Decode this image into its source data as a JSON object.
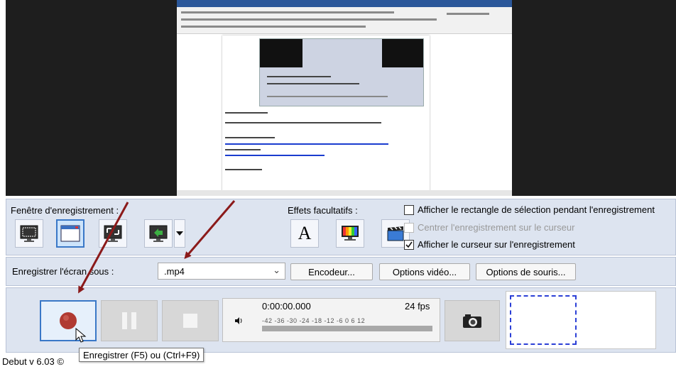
{
  "recording_panel": {
    "label": "Fenêtre d'enregistrement :",
    "effects_label": "Effets facultatifs :",
    "options": [
      {
        "label": "Afficher le rectangle de sélection pendant l'enregistrement",
        "checked": false,
        "enabled": true
      },
      {
        "label": "Centrer l'enregistrement sur le curseur",
        "checked": false,
        "enabled": false
      },
      {
        "label": "Afficher le curseur sur l'enregistrement",
        "checked": true,
        "enabled": true
      }
    ]
  },
  "format_bar": {
    "label": "Enregistrer l'écran sous :",
    "format_value": ".mp4",
    "encoder_button": "Encodeur...",
    "video_options_button": "Options vidéo...",
    "mouse_options_button": "Options de souris..."
  },
  "transport": {
    "time": "0:00:00.000",
    "fps": "24 fps",
    "meter_ticks": "-42  -36  -30  -24  -18  -12   -6    0    6  12"
  },
  "tooltip": "Enregistrer (F5) ou (Ctrl+F9)",
  "footer": {
    "version": "Debut v 6.03 ©"
  },
  "colors": {
    "panel_bg": "#dde4f0",
    "record_red": "#c0392b",
    "arrow": "#8b1a1a",
    "selection_blue": "#2b3fd6"
  }
}
